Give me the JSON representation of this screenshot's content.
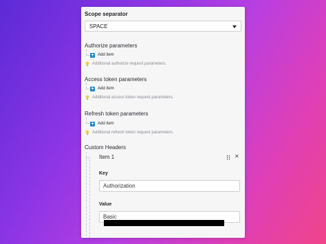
{
  "scope_separator": {
    "label": "Scope separator",
    "value": "SPACE"
  },
  "authorize": {
    "label": "Authorize parameters",
    "add_label": "Add item",
    "hint": "Additional authorize request parameters."
  },
  "access": {
    "label": "Access token parameters",
    "add_label": "Add item",
    "hint": "Additional access token request parameters."
  },
  "refresh": {
    "label": "Refresh token parameters",
    "add_label": "Add item",
    "hint": "Additional refresh token request parameters."
  },
  "custom_headers": {
    "label": "Custom Headers",
    "item_title": "Item 1",
    "key_label": "Key",
    "key_value": "Authorization",
    "value_label": "Value",
    "value_text": "Basic"
  },
  "icons": {
    "caret": "chevron-down-icon",
    "add": "plus-icon",
    "hint": "lightbulb-icon",
    "drag": "drag-handle-icon",
    "close": "close-icon"
  },
  "colors": {
    "accent": "#1d8bc7",
    "hint_icon": "#f2c94c"
  }
}
